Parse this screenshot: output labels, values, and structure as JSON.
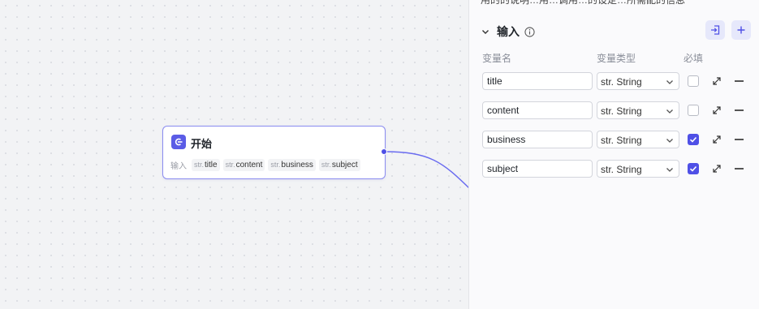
{
  "node": {
    "title": "开始",
    "input_label": "输入",
    "chips": [
      {
        "type": "str.",
        "name": "title"
      },
      {
        "type": "str.",
        "name": "content"
      },
      {
        "type": "str.",
        "name": "business"
      },
      {
        "type": "str.",
        "name": "subject"
      }
    ]
  },
  "panel": {
    "top_text": "用的的说明…用…调用…的设定…所需配的信息",
    "section_title": "输入",
    "columns": {
      "name": "变量名",
      "type": "变量类型",
      "required": "必填"
    },
    "rows": [
      {
        "name": "title",
        "type": "str. String",
        "required": false
      },
      {
        "name": "content",
        "type": "str. String",
        "required": false
      },
      {
        "name": "business",
        "type": "str. String",
        "required": true
      },
      {
        "name": "subject",
        "type": "str. String",
        "required": true
      }
    ]
  },
  "colors": {
    "accent": "#4f50e6",
    "node_border": "#8b8cf0",
    "edge": "#6a6cf0"
  }
}
